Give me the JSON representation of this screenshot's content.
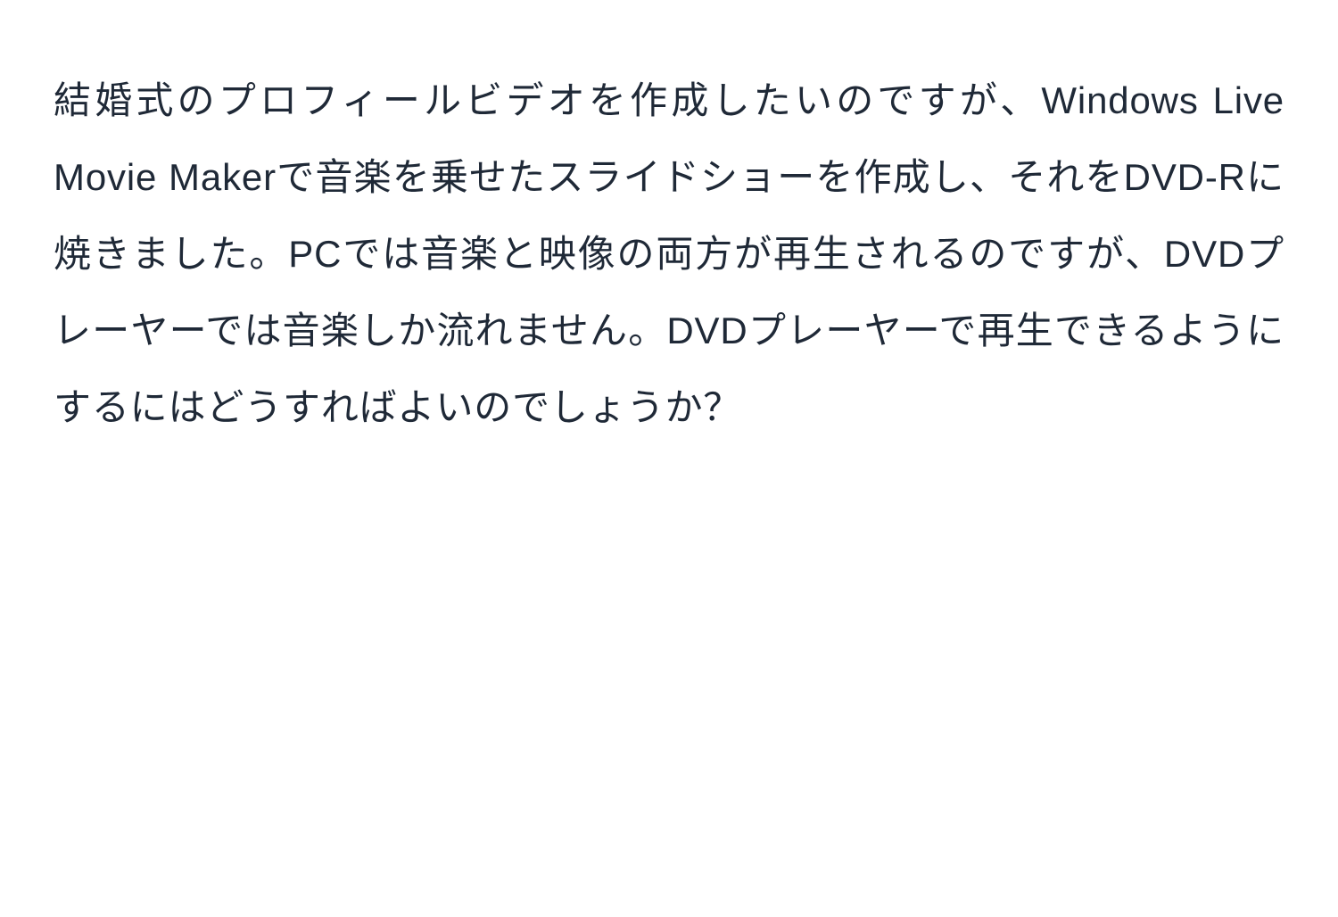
{
  "body": {
    "text": "結婚式のプロフィールビデオを作成したいのですが、Windows Live Movie Makerで音楽を乗せたスライドショーを作成し、それをDVD-Rに焼きました。PCでは音楽と映像の両方が再生されるのですが、DVDプレーヤーでは音楽しか流れません。DVDプレーヤーで再生できるようにするにはどうすればよいのでしょうか？"
  }
}
